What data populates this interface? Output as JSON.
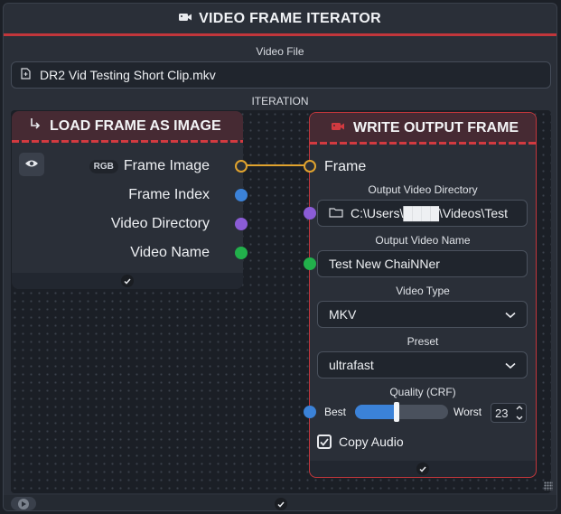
{
  "iterator": {
    "title": "VIDEO FRAME ITERATOR",
    "title_icon": "video-camera-icon",
    "video_file_label": "Video File",
    "video_file_value": "DR2 Vid Testing Short Clip.mkv",
    "file_icon": "file-icon",
    "iteration_label": "ITERATION",
    "accent_color": "#c2363b"
  },
  "load_node": {
    "title": "LOAD FRAME AS IMAGE",
    "title_icon": "arrow-down-right-icon",
    "outputs": [
      {
        "label": "Frame Image",
        "badge": "RGB",
        "color": "#e0a32e"
      },
      {
        "label": "Frame Index",
        "color": "#3b82d8"
      },
      {
        "label": "Video Directory",
        "color": "#8b5cd6"
      },
      {
        "label": "Video Name",
        "color": "#22b04b"
      }
    ]
  },
  "write_node": {
    "title": "WRITE OUTPUT FRAME",
    "title_icon": "video-camera-icon",
    "frame_label": "Frame",
    "output_dir_label": "Output Video Directory",
    "output_dir_value": "C:\\Users\\████\\Videos\\Test",
    "output_name_label": "Output Video Name",
    "output_name_value": "Test New ChaiNNer",
    "video_type_label": "Video Type",
    "video_type_value": "MKV",
    "preset_label": "Preset",
    "preset_value": "ultrafast",
    "quality_label": "Quality (CRF)",
    "quality_min_label": "Best",
    "quality_max_label": "Worst",
    "quality_value": "23",
    "quality_fraction": 0.45,
    "copy_audio_label": "Copy Audio",
    "copy_audio_checked": true,
    "input_colors": {
      "directory": "#8b5cd6",
      "name": "#22b04b",
      "quality": "#3b82d8"
    }
  }
}
